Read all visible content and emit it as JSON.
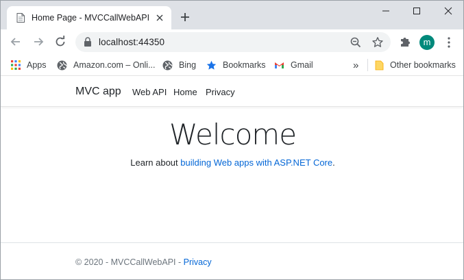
{
  "browser": {
    "tab": {
      "title": "Home Page - MVCCallWebAPI"
    },
    "address": {
      "url": "localhost:44350"
    },
    "profile_initial": "m",
    "bookmarks": [
      {
        "label": "Apps"
      },
      {
        "label": "Amazon.com – Onli..."
      },
      {
        "label": "Bing"
      },
      {
        "label": "Bookmarks"
      },
      {
        "label": "Gmail"
      }
    ],
    "overflow_chevron": "»",
    "other_bookmarks": "Other bookmarks"
  },
  "site": {
    "brand": "MVC app",
    "nav": [
      "Web API",
      "Home",
      "Privacy"
    ],
    "heading": "Welcome",
    "learn_prefix": "Learn about ",
    "learn_link": "building Web apps with ASP.NET Core",
    "learn_suffix": ".",
    "footer_prefix": "© 2020 - MVCCallWebAPI - ",
    "footer_link": "Privacy"
  },
  "colors": {
    "tabstrip": "#dee1e6",
    "link": "#0366d6",
    "avatar": "#00897b"
  },
  "icons": [
    "page-icon",
    "close-icon",
    "plus-icon",
    "minimize-icon",
    "maximize-icon",
    "window-close-icon",
    "back-arrow-icon",
    "forward-arrow-icon",
    "reload-icon",
    "lock-icon",
    "zoom-out-icon",
    "star-icon",
    "puzzle-icon",
    "menu-dots-icon",
    "apps-grid-icon",
    "globe-icon",
    "bookmark-star-icon",
    "gmail-icon",
    "folder-icon"
  ]
}
